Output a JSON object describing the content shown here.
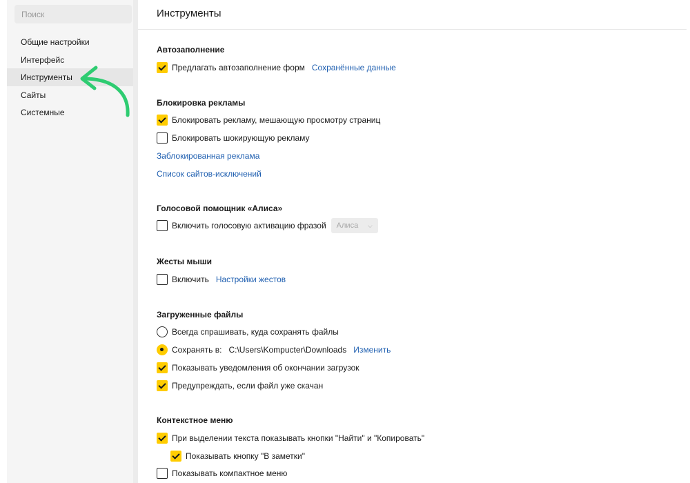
{
  "sidebar": {
    "search_placeholder": "Поиск",
    "items": [
      {
        "label": "Общие настройки"
      },
      {
        "label": "Интерфейс"
      },
      {
        "label": "Инструменты",
        "active": true
      },
      {
        "label": "Сайты"
      },
      {
        "label": "Системные"
      }
    ],
    "annotation": {
      "icon": "curved-arrow-icon",
      "color": "#2ecc71"
    }
  },
  "page": {
    "title": "Инструменты"
  },
  "autofill": {
    "title": "Автозаполнение",
    "offer_label": "Предлагать автозаполнение форм",
    "offer_checked": true,
    "saved_link": "Сохранённые данные"
  },
  "adblock": {
    "title": "Блокировка рекламы",
    "block_label": "Блокировать рекламу, мешающую просмотру страниц",
    "block_checked": true,
    "shock_label": "Блокировать шокирующую рекламу",
    "shock_checked": false,
    "blocked_link": "Заблокированная реклама",
    "exceptions_link": "Список сайтов-исключений"
  },
  "alice": {
    "title": "Голосовой помощник «Алиса»",
    "voice_label": "Включить голосовую активацию фразой",
    "voice_checked": false,
    "phrase_selected": "Алиса"
  },
  "gestures": {
    "title": "Жесты мыши",
    "enable_label": "Включить",
    "enable_checked": false,
    "settings_link": "Настройки жестов"
  },
  "downloads": {
    "title": "Загруженные файлы",
    "ask_label": "Всегда спрашивать, куда сохранять файлы",
    "ask_selected": false,
    "save_label": "Сохранять в:",
    "save_selected": true,
    "save_path": "C:\\Users\\Kompucter\\Downloads",
    "change_link": "Изменить",
    "notify_label": "Показывать уведомления об окончании загрузок",
    "notify_checked": true,
    "warn_label": "Предупреждать, если файл уже скачан",
    "warn_checked": true
  },
  "context_menu": {
    "title": "Контекстное меню",
    "selection_label": "При выделении текста показывать кнопки \"Найти\" и \"Копировать\"",
    "selection_checked": true,
    "notes_label": "Показывать кнопку \"В заметки\"",
    "notes_checked": true,
    "compact_label": "Показывать компактное меню",
    "compact_checked": false
  },
  "colors": {
    "accent": "#ffcc00",
    "link": "#1f5fb0",
    "annotation_arrow": "#2ecc71"
  }
}
